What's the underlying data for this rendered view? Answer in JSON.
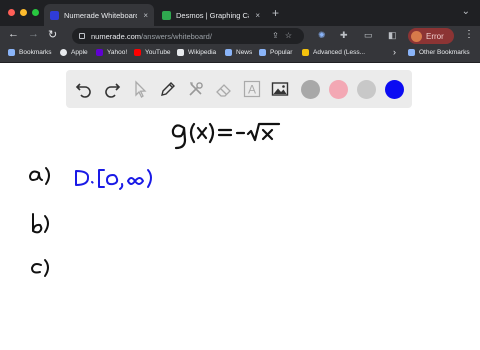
{
  "browser": {
    "tabs": [
      {
        "title": "Numerade Whiteboard",
        "close": "×",
        "favicon_color": "#2f3cd8",
        "active": true
      },
      {
        "title": "Desmos | Graphing Calculator",
        "close": "×",
        "favicon_color": "#2fa84f",
        "active": false
      }
    ],
    "new_tab": "+",
    "tab_search": "⌄",
    "address": {
      "domain": "numerade.com",
      "path": "/answers/whiteboard/"
    },
    "profile_button": "Error",
    "bookmarks": [
      {
        "label": "Bookmarks",
        "color": "#8ab4f8"
      },
      {
        "label": "Apple",
        "color": "#e8eaed"
      },
      {
        "label": "Yahoo!",
        "color": "#6001d2"
      },
      {
        "label": "YouTube",
        "color": "#ff0000"
      },
      {
        "label": "Wikipedia",
        "color": "#e8eaed"
      },
      {
        "label": "News",
        "color": "#8ab4f8"
      },
      {
        "label": "Popular",
        "color": "#8ab4f8"
      },
      {
        "label": "Advanced (Less...",
        "color": "#f4c20d"
      }
    ],
    "bookmarks_more": "›",
    "other_bookmarks": "Other Bookmarks"
  },
  "whiteboard": {
    "tools": [
      "undo-icon",
      "redo-icon",
      "select-icon",
      "pen-icon",
      "tools-icon",
      "eraser-icon",
      "text-icon",
      "image-icon"
    ],
    "text_tool_glyph": "A",
    "colors": [
      "#a8a8a8",
      "#f3a8b4",
      "#c8c8c8",
      "#0b0bf2"
    ]
  }
}
